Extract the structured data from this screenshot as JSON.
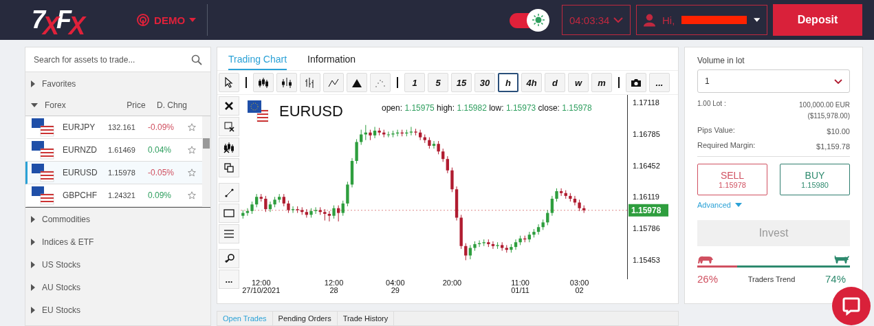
{
  "header": {
    "logo": "7XFX",
    "account_mode": {
      "label": "DEMO"
    },
    "theme_toggle": {
      "on": true
    },
    "clock": "04:03:34",
    "user": {
      "greeting": "Hi,"
    },
    "deposit_button": "Deposit"
  },
  "sidebar": {
    "search": {
      "placeholder": "Search for assets to trade..."
    },
    "categories": [
      {
        "label": "Favorites",
        "expanded": false
      },
      {
        "label": "Forex",
        "expanded": true,
        "columns": [
          "Price",
          "D. Chng"
        ],
        "rows": [
          {
            "symbol": "EURJPY",
            "price": "132.161",
            "change": "-0.09%",
            "color": "#d05060",
            "favorite": false,
            "selected": false
          },
          {
            "symbol": "EURNZD",
            "price": "1.61469",
            "change": "0.04%",
            "color": "#2e9e5e",
            "favorite": false,
            "selected": false
          },
          {
            "symbol": "EURUSD",
            "price": "1.15978",
            "change": "-0.05%",
            "color": "#d05060",
            "favorite": false,
            "selected": true
          },
          {
            "symbol": "GBPCHF",
            "price": "1.24321",
            "change": "0.09%",
            "color": "#2e9e5e",
            "favorite": false,
            "selected": false
          }
        ]
      },
      {
        "label": "Commodities",
        "expanded": false
      },
      {
        "label": "Indices & ETF",
        "expanded": false
      },
      {
        "label": "US Stocks",
        "expanded": false
      },
      {
        "label": "AU Stocks",
        "expanded": false
      },
      {
        "label": "EU Stocks",
        "expanded": false
      }
    ]
  },
  "chart_panel": {
    "tabs": [
      {
        "label": "Trading Chart",
        "selected": true
      },
      {
        "label": "Information",
        "selected": false
      }
    ],
    "chart_types": [
      {
        "kind": "candles",
        "selected": false
      },
      {
        "kind": "bars",
        "selected": false
      },
      {
        "kind": "ohlc",
        "selected": false
      },
      {
        "kind": "line",
        "selected": false
      },
      {
        "kind": "area",
        "selected": false
      },
      {
        "kind": "dots",
        "selected": false
      }
    ],
    "timeframes": [
      {
        "label": "1",
        "selected": false
      },
      {
        "label": "5",
        "selected": false
      },
      {
        "label": "15",
        "selected": false
      },
      {
        "label": "30",
        "selected": false
      },
      {
        "label": "h",
        "selected": true
      },
      {
        "label": "4h",
        "selected": false
      },
      {
        "label": "d",
        "selected": false
      },
      {
        "label": "w",
        "selected": false
      },
      {
        "label": "m",
        "selected": false
      }
    ],
    "more_button": "...",
    "side_tools": [
      {
        "kind": "close"
      },
      {
        "kind": "select"
      },
      {
        "kind": "delete-all"
      },
      {
        "kind": "clone"
      },
      {
        "kind": "trendline"
      },
      {
        "kind": "rectangle"
      },
      {
        "kind": "lines"
      },
      {
        "kind": "zoom"
      },
      {
        "kind": "more",
        "label": "..."
      }
    ],
    "symbol": "EURUSD",
    "ohlc": [
      {
        "label": "open:",
        "value": "1.15975"
      },
      {
        "label": "high:",
        "value": "1.15982"
      },
      {
        "label": "low:",
        "value": "1.15973"
      },
      {
        "label": "close:",
        "value": "1.15978"
      }
    ],
    "chart_data": {
      "type": "candlestick",
      "categories": [
        null,
        null,
        null,
        null,
        null,
        null,
        null,
        null,
        null,
        null,
        null,
        null,
        null,
        null,
        null,
        null,
        null,
        null,
        null,
        null,
        null,
        null,
        null,
        null,
        null,
        null,
        null,
        null,
        null,
        null,
        null,
        null,
        null,
        null,
        null,
        null,
        null,
        null,
        null,
        null,
        null,
        null,
        null,
        null,
        null,
        null,
        null,
        null,
        null,
        null,
        null,
        null,
        null,
        null,
        null,
        null,
        null,
        null,
        null,
        null,
        null,
        null,
        null,
        null,
        null,
        null,
        null,
        null,
        null,
        null,
        null,
        null,
        null,
        null,
        null,
        null,
        null,
        null,
        null,
        null,
        null,
        null,
        null,
        null,
        null
      ],
      "ohlc": [
        [
          1.1592,
          1.1598,
          1.1589,
          1.1595
        ],
        [
          1.1595,
          1.16,
          1.1592,
          1.1597
        ],
        [
          1.1597,
          1.1607,
          1.1594,
          1.1604
        ],
        [
          1.1604,
          1.1615,
          1.1601,
          1.1612
        ],
        [
          1.1612,
          1.1615,
          1.1607,
          1.161
        ],
        [
          1.161,
          1.1613,
          1.1596,
          1.1599
        ],
        [
          1.1599,
          1.1607,
          1.1596,
          1.1604
        ],
        [
          1.1604,
          1.1612,
          1.1601,
          1.1609
        ],
        [
          1.1609,
          1.1615,
          1.1606,
          1.1612
        ],
        [
          1.1612,
          1.1615,
          1.1602,
          1.1605
        ],
        [
          1.1605,
          1.1608,
          1.1595,
          1.1598
        ],
        [
          1.1598,
          1.1602,
          1.1595,
          1.1599
        ],
        [
          1.1599,
          1.1602,
          1.1595,
          1.1598
        ],
        [
          1.1598,
          1.1601,
          1.1593,
          1.1596
        ],
        [
          1.1596,
          1.1599,
          1.159,
          1.1593
        ],
        [
          1.1593,
          1.16,
          1.159,
          1.1597
        ],
        [
          1.1597,
          1.1601,
          1.1594,
          1.1598
        ],
        [
          1.1598,
          1.1601,
          1.1593,
          1.1596
        ],
        [
          1.1596,
          1.1599,
          1.1587,
          1.1594
        ],
        [
          1.1594,
          1.1597,
          1.1586,
          1.1592
        ],
        [
          1.1592,
          1.1603,
          1.1589,
          1.16
        ],
        [
          1.16,
          1.1603,
          1.1586,
          1.1595
        ],
        [
          1.1595,
          1.1608,
          1.1592,
          1.1605
        ],
        [
          1.1605,
          1.1628,
          1.1602,
          1.1625
        ],
        [
          1.1625,
          1.1653,
          1.1622,
          1.165
        ],
        [
          1.165,
          1.1673,
          1.1647,
          1.167
        ],
        [
          1.167,
          1.1683,
          1.1667,
          1.1678
        ],
        [
          1.1678,
          1.1688,
          1.1672,
          1.168
        ],
        [
          1.168,
          1.1683,
          1.1672,
          1.1677
        ],
        [
          1.1677,
          1.1686,
          1.1674,
          1.1682
        ],
        [
          1.1682,
          1.1685,
          1.1677,
          1.168
        ],
        [
          1.168,
          1.1683,
          1.1675,
          1.1678
        ],
        [
          1.1678,
          1.1681,
          1.1675,
          1.1678
        ],
        [
          1.1678,
          1.1682,
          1.1675,
          1.1679
        ],
        [
          1.1679,
          1.1683,
          1.1676,
          1.168
        ],
        [
          1.168,
          1.1683,
          1.1676,
          1.1679
        ],
        [
          1.1679,
          1.1683,
          1.1676,
          1.168
        ],
        [
          1.168,
          1.1686,
          1.1677,
          1.1681
        ],
        [
          1.1681,
          1.1684,
          1.1677,
          1.168
        ],
        [
          1.168,
          1.1683,
          1.1672,
          1.1675
        ],
        [
          1.1675,
          1.1678,
          1.1669,
          1.1672
        ],
        [
          1.1672,
          1.1675,
          1.1663,
          1.1666
        ],
        [
          1.1666,
          1.1671,
          1.1663,
          1.1668
        ],
        [
          1.1668,
          1.1671,
          1.1657,
          1.166
        ],
        [
          1.166,
          1.1663,
          1.1649,
          1.1652
        ],
        [
          1.1652,
          1.1655,
          1.1637,
          1.164
        ],
        [
          1.164,
          1.1643,
          1.1617,
          1.162
        ],
        [
          1.162,
          1.1623,
          1.1587,
          1.159
        ],
        [
          1.159,
          1.1593,
          1.1557,
          1.156
        ],
        [
          1.156,
          1.1563,
          1.1545,
          1.155
        ],
        [
          1.155,
          1.1561,
          1.1546,
          1.1558
        ],
        [
          1.1558,
          1.1565,
          1.1555,
          1.1562
        ],
        [
          1.1562,
          1.1566,
          1.1559,
          1.1563
        ],
        [
          1.1563,
          1.1567,
          1.156,
          1.1564
        ],
        [
          1.1564,
          1.1567,
          1.1559,
          1.1562
        ],
        [
          1.1562,
          1.1565,
          1.1557,
          1.156
        ],
        [
          1.156,
          1.1564,
          1.1557,
          1.1561
        ],
        [
          1.1561,
          1.1564,
          1.1555,
          1.1558
        ],
        [
          1.1558,
          1.1561,
          1.1553,
          1.1556
        ],
        [
          1.1556,
          1.1562,
          1.1553,
          1.1559
        ],
        [
          1.1559,
          1.1567,
          1.1556,
          1.1564
        ],
        [
          1.1564,
          1.1571,
          1.1561,
          1.1568
        ],
        [
          1.1568,
          1.1571,
          1.1564,
          1.1567
        ],
        [
          1.1567,
          1.1575,
          1.1564,
          1.1572
        ],
        [
          1.1572,
          1.1578,
          1.1569,
          1.1575
        ],
        [
          1.1575,
          1.1583,
          1.1572,
          1.158
        ],
        [
          1.158,
          1.1588,
          1.1577,
          1.1585
        ],
        [
          1.1585,
          1.1598,
          1.1582,
          1.1595
        ],
        [
          1.1595,
          1.1613,
          1.1592,
          1.161
        ],
        [
          1.161,
          1.1621,
          1.1607,
          1.1618
        ],
        [
          1.1618,
          1.1621,
          1.1613,
          1.1616
        ],
        [
          1.1616,
          1.1619,
          1.161,
          1.1613
        ],
        [
          1.1613,
          1.1616,
          1.1607,
          1.161
        ],
        [
          1.161,
          1.1613,
          1.1603,
          1.1606
        ],
        [
          1.1606,
          1.1609,
          1.1597,
          1.16
        ],
        [
          1.16,
          1.1603,
          1.1595,
          1.15978
        ],
        null,
        null,
        null,
        null,
        null,
        null,
        null,
        null,
        null
      ],
      "ylim": [
        1.15249,
        1.17198
      ],
      "ref_lines": [
        {
          "axis": "y",
          "value": 1.15978,
          "label": "1.15978"
        }
      ],
      "yticks": [
        1.17118,
        1.16785,
        1.16452,
        1.16119,
        1.15786,
        1.15453
      ]
    },
    "x_axis_labels": [
      {
        "time": "12:00",
        "date": "27/10/2021"
      },
      {
        "time": "12:00",
        "date": "28"
      },
      {
        "time": "04:00",
        "date": "29"
      },
      {
        "time": "20:00"
      },
      {
        "time": "11:00",
        "date": "01/11"
      },
      {
        "time": "03:00",
        "date": "02"
      }
    ]
  },
  "bottom_tabs": [
    {
      "label": "Open Trades",
      "selected": true
    },
    {
      "label": "Pending Orders",
      "selected": false
    },
    {
      "label": "Trade History",
      "selected": false
    }
  ],
  "order_panel": {
    "volume_label": "Volume in lot",
    "volume_value": "1",
    "details": [
      {
        "label": "1.00 Lot :",
        "value": "100,000.00 EUR",
        "subvalue": "($115,978.00)"
      },
      {
        "label": "Pips Value:",
        "value": "$10.00"
      },
      {
        "label": "Required Margin:",
        "value": "$1,159.78"
      }
    ],
    "sell": {
      "label": "SELL",
      "price": "1.15978"
    },
    "buy": {
      "label": "BUY",
      "price": "1.15980"
    },
    "advanced_link": "Advanced",
    "invest_button": {
      "label": "Invest",
      "disabled": true
    },
    "traders_trend": {
      "level": 0.26,
      "sell_percent": "26%",
      "label": "Traders Trend",
      "buy_percent": "74%"
    }
  }
}
